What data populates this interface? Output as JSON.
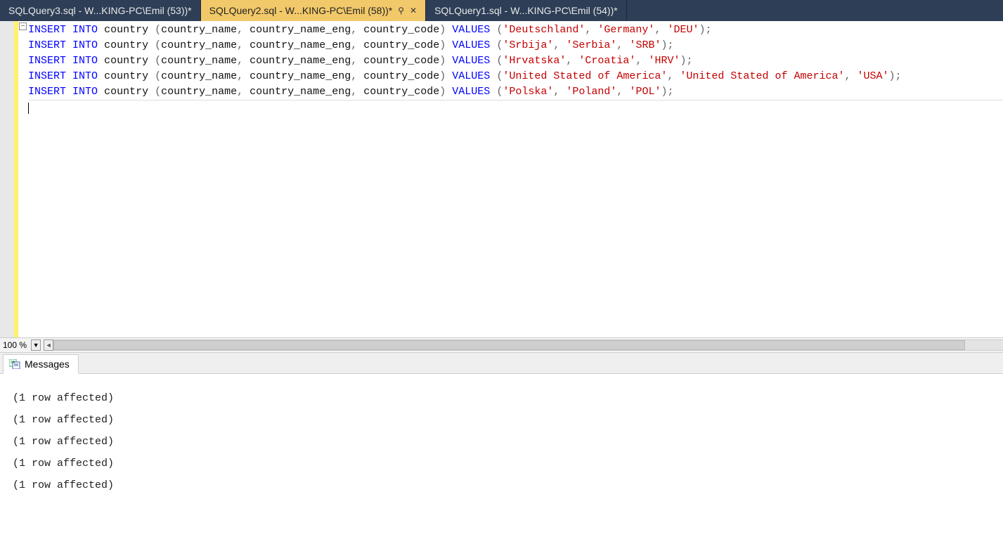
{
  "tabs": [
    {
      "label": "SQLQuery3.sql - W...KING-PC\\Emil (53))*",
      "active": false
    },
    {
      "label": "SQLQuery2.sql - W...KING-PC\\Emil (58))*",
      "active": true
    },
    {
      "label": "SQLQuery1.sql - W...KING-PC\\Emil (54))*",
      "active": false
    }
  ],
  "zoom": "100 %",
  "results_tab_label": "Messages",
  "messages": [
    "(1 row affected)",
    "(1 row affected)",
    "(1 row affected)",
    "(1 row affected)",
    "(1 row affected)"
  ],
  "sql": {
    "cmd_insert": "INSERT",
    "cmd_into": "INTO",
    "table": "country",
    "lp": "(",
    "rp": ")",
    "cm": ",",
    "sc": ";",
    "col1": "country_name",
    "col2": "country_name_eng",
    "col3": "country_code",
    "values_kw": "VALUES",
    "rows": [
      {
        "v1": "'Deutschland'",
        "v2": "'Germany'",
        "v3": "'DEU'"
      },
      {
        "v1": "'Srbija'",
        "v2": "'Serbia'",
        "v3": "'SRB'"
      },
      {
        "v1": "'Hrvatska'",
        "v2": "'Croatia'",
        "v3": "'HRV'"
      },
      {
        "v1": "'United Stated of America'",
        "v2": "'United Stated of America'",
        "v3": "'USA'"
      },
      {
        "v1": "'Polska'",
        "v2": "'Poland'",
        "v3": "'POL'"
      }
    ]
  }
}
